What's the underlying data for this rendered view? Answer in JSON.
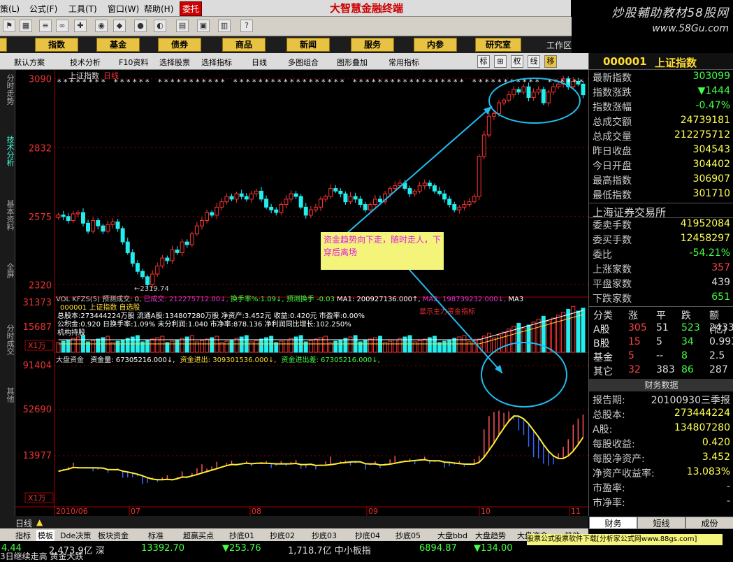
{
  "menu": {
    "items": [
      "策(L)",
      "公式(F)",
      "工具(T)",
      "窗口(W)",
      "帮助(H)"
    ],
    "entrust": "委托",
    "title": "大智慧金融终端"
  },
  "watermark": {
    "line1": "炒股輔助教材58股网",
    "line2": "www.58Gu.com"
  },
  "nav": {
    "items": [
      "股",
      "指数",
      "基金",
      "债券",
      "商品",
      "新闻",
      "服务",
      "内参",
      "研究室"
    ],
    "workarea": "工作区"
  },
  "toolbar2": {
    "items": [
      "默认方案",
      "技术分析",
      "F10资料",
      "选择股票",
      "选择指标",
      "日线",
      "多图组合",
      "图形叠加",
      "常用指标"
    ],
    "switches": [
      "标",
      "⊞",
      "权",
      "线",
      "移"
    ]
  },
  "left_tabs": [
    "分时走势",
    "技术分析",
    "基本资料",
    "全屏",
    "分时成交",
    "其他"
  ],
  "chart": {
    "title": "上证指数",
    "period": "日线",
    "low_label": "←2319.74"
  },
  "vol_header": {
    "left": "VOL KFZS(5) 预测成交: 0, ",
    "yi": "已成交:",
    "yi_v": "212275712.00↓,",
    "hs": "换手率%:1.09↓,",
    "kp": "预测换手 -0.03",
    "ma1": "MA1: 200927136.000↑,",
    "ma2": "MA2: 198739232.000↓,",
    "ma3": "MA3"
  },
  "fund": {
    "code_name": "000001 上证指数 自选股",
    "line1": "总股本:273444224万股 流通A股:134807280万股 净资产:3.452元 收益:0.420元 市盈率:0.00%",
    "line2": "公积金:0.920 日换手率:1.09% 未分利润:1.040 市净率:878.136 净利润同比增长:102.250%",
    "line3": "机构持股",
    "red_note": "显示主力资金指标"
  },
  "capital_header": {
    "name": "大盘资金",
    "amt": "资金量: 67305216.000↓,",
    "in": "资金进出: 309301536.000↓,",
    "diff": "资金进出差: 67305216.000↓,"
  },
  "axis": {
    "price_ticks": [
      "3090",
      "2832",
      "2575",
      "2320"
    ],
    "vol_ticks": [
      "31373",
      "15687"
    ],
    "cap_ticks": [
      "91404",
      "52690",
      "13977"
    ],
    "unit": "X1万",
    "x_labels": [
      "2010/06",
      "07",
      "08",
      "09",
      "10",
      "11"
    ]
  },
  "annotation": "资金趋势向下走，随时走人，下穿后离场",
  "quote": {
    "code": "000001",
    "name": "上证指数",
    "rows": [
      [
        "最新指数",
        "303099"
      ],
      [
        "指数涨跌",
        "▼1444"
      ],
      [
        "指数涨幅",
        "-0.47%"
      ],
      [
        "总成交额",
        "24739181"
      ],
      [
        "总成交量",
        "212275712"
      ],
      [
        "昨日收盘",
        "304543"
      ],
      [
        "今日开盘",
        "304402"
      ],
      [
        "最高指数",
        "306907"
      ],
      [
        "最低指数",
        "301710"
      ]
    ],
    "exchange": "上海证券交易所",
    "rows2": [
      [
        "委卖手数",
        "41952084"
      ],
      [
        "委买手数",
        "12458297"
      ],
      [
        "委比",
        "-54.21%"
      ],
      [
        "上涨家数",
        "357"
      ],
      [
        "平盘家数",
        "439"
      ],
      [
        "下跌家数",
        "651"
      ]
    ],
    "breadth_header": [
      "分类",
      "涨",
      "平",
      "跌",
      "额(亿)"
    ],
    "breadth": [
      [
        "A股",
        "305",
        "51",
        "523",
        "2433"
      ],
      [
        "B股",
        "15",
        "5",
        "34",
        "0.993"
      ],
      [
        "基金",
        "5",
        "--",
        "8",
        "2.5"
      ],
      [
        "其它",
        "32",
        "383",
        "86",
        "287"
      ]
    ],
    "fin_title": "财务数据",
    "fin": [
      [
        "报告期:",
        "20100930三季报"
      ],
      [
        "总股本:",
        "273444224"
      ],
      [
        "A股:",
        "134807280"
      ],
      [
        "每股收益:",
        "0.420"
      ],
      [
        "每股净资产:",
        "3.452"
      ],
      [
        "净资产收益率:",
        "13.083%"
      ],
      [
        "市盈率:",
        "-"
      ],
      [
        "市净率:",
        "-"
      ]
    ],
    "tabs": [
      "财务",
      "短线",
      "成份"
    ]
  },
  "statusbar": {
    "period": "日线",
    "items": [
      "指标",
      "模板",
      "Dde决策",
      "板块资金",
      "标准",
      "超赢买点",
      "抄底01",
      "抄底02",
      "抄底03",
      "抄底04",
      "抄底05",
      "大盘bbd",
      "大盘趋势",
      "大盘资金",
      "其他"
    ]
  },
  "ticker": {
    "t1": "4.44",
    "t2": "2,473.9亿 深",
    "t3": "13392.70",
    "t4": "▼253.76",
    "t5": "1,718.7亿 中小板指",
    "t6": "6894.87",
    "t7": "▼134.00",
    "t8": "3日继续走高 黄金大跌",
    "ad": "股票公式股票软件下载[分析家公式网www.88gs.com]"
  },
  "chart_data": [
    {
      "type": "candlestick",
      "title": "上证指数 日线",
      "y_ticks": [
        3090,
        2832,
        2575,
        2320
      ],
      "ylim": [
        2300,
        3110
      ],
      "x_labels": [
        "2010/06",
        "07",
        "08",
        "09",
        "10",
        "11"
      ],
      "close": [
        2581,
        2575,
        2560,
        2585,
        2590,
        2550,
        2520,
        2560,
        2540,
        2520,
        2545,
        2555,
        2530,
        2480,
        2440,
        2400,
        2370,
        2350,
        2320,
        2360,
        2390,
        2420,
        2410,
        2450,
        2440,
        2480,
        2470,
        2510,
        2540,
        2560,
        2590,
        2580,
        2610,
        2630,
        2650,
        2640,
        2660,
        2650,
        2640,
        2660,
        2670,
        2640,
        2610,
        2600,
        2590,
        2620,
        2640,
        2660,
        2650,
        2610,
        2580,
        2600,
        2610,
        2640,
        2650,
        2680,
        2670,
        2660,
        2630,
        2650,
        2640,
        2620,
        2600,
        2620,
        2640,
        2630,
        2660,
        2680,
        2690,
        2700,
        2680,
        2660,
        2670,
        2690,
        2700,
        2690,
        2670,
        2660,
        2640,
        2620,
        2600,
        2610,
        2620,
        2630,
        2650,
        2800,
        2880,
        2950,
        2960,
        3000,
        3010,
        3030,
        3050,
        3040,
        3060,
        3020,
        3040,
        3050,
        3000,
        3040,
        3060,
        3070,
        3090,
        3060,
        3080,
        3070,
        3030
      ]
    },
    {
      "type": "bar",
      "title": "VOL KFZS(5)",
      "y_ticks": [
        31373,
        15687
      ],
      "unit": "X1万",
      "yi_cheng_jiao": 212275712,
      "ma1": 200927136,
      "ma2": 198739232
    },
    {
      "type": "bar+line",
      "title": "大盘资金",
      "y_ticks": [
        91404,
        52690,
        13977
      ],
      "unit": "X1万",
      "zi_jin_liang": 67305216,
      "zi_jin_jin_chu": 309301536,
      "zi_jin_jin_chu_cha": 67305216
    }
  ]
}
